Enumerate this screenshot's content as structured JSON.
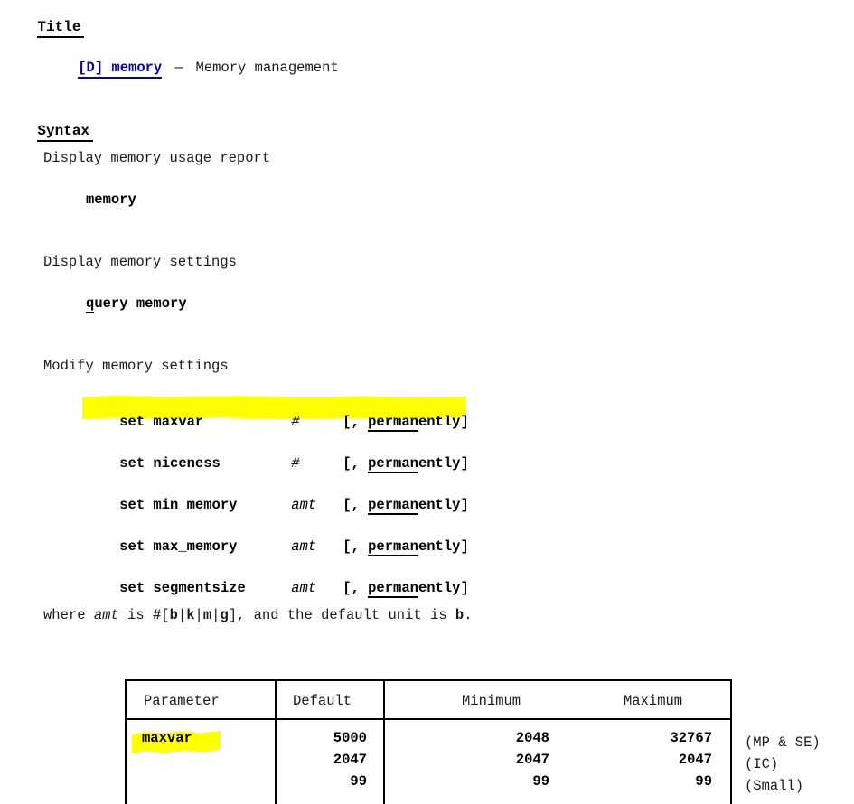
{
  "document": {
    "sections": [
      {
        "id": "title",
        "heading": "Title"
      },
      {
        "id": "syntax",
        "heading": "Syntax"
      }
    ]
  },
  "title_section": {
    "link_label": "[D] memory",
    "dash": "—",
    "description": "Memory management"
  },
  "syntax_section": {
    "blocks": [
      {
        "caption": "Display memory usage report",
        "command": "memory",
        "abbrev": "",
        "rest": "memory"
      },
      {
        "caption": "Display memory settings",
        "command": "query memory",
        "abbrev": "q",
        "rest": "uery memory"
      },
      {
        "caption": "Modify memory settings"
      }
    ],
    "set_commands": [
      {
        "command": "set maxvar",
        "argument": "#",
        "argument_italic": true,
        "option_open": "[, ",
        "option_abbrev": "perman",
        "option_rest": "ently",
        "option_close": "]",
        "highlighted": true
      },
      {
        "command": "set niceness",
        "argument": "#",
        "argument_italic": true,
        "option_open": "[, ",
        "option_abbrev": "perman",
        "option_rest": "ently",
        "option_close": "]",
        "highlighted": false
      },
      {
        "command": "set min_memory",
        "argument": "amt",
        "argument_italic": true,
        "option_open": "[, ",
        "option_abbrev": "perman",
        "option_rest": "ently",
        "option_close": "]",
        "highlighted": false
      },
      {
        "command": "set max_memory",
        "argument": "amt",
        "argument_italic": true,
        "option_open": "[, ",
        "option_abbrev": "perman",
        "option_rest": "ently",
        "option_close": "]",
        "highlighted": false
      },
      {
        "command": "set segmentsize",
        "argument": "amt",
        "argument_italic": true,
        "option_open": "[, ",
        "option_abbrev": "perman",
        "option_rest": "ently",
        "option_close": "]",
        "highlighted": false
      }
    ],
    "where_note": {
      "p1": "where ",
      "amt": "amt",
      "p2": " is ",
      "hash": "#",
      "br_open": "[",
      "u_b": "b",
      "pipe1": "|",
      "u_k": "k",
      "pipe2": "|",
      "u_m": "m",
      "pipe3": "|",
      "u_g": "g",
      "br_close": "],",
      "p3": " and the default unit is ",
      "unit": "b",
      "p4": "."
    }
  },
  "parameter_table": {
    "columns": [
      "Parameter",
      "Default",
      "Minimum",
      "Maximum"
    ],
    "rows": [
      {
        "parameter": "maxvar",
        "parameter_highlighted": true,
        "default": [
          "5000",
          "2047",
          "99"
        ],
        "minimum": [
          "2048",
          "2047",
          "99"
        ],
        "maximum": [
          "32767",
          "2047",
          "99"
        ],
        "notes": [
          "(MP & SE)",
          "(IC)",
          "(Small)"
        ]
      }
    ],
    "notes_block": "(MP & SE)\n(IC)\n(Small)"
  },
  "colors": {
    "link": "#0000c8",
    "highlight": "#ffff00",
    "text": "#1a1a1a",
    "rule": "#000000",
    "background": "#ffffff"
  }
}
